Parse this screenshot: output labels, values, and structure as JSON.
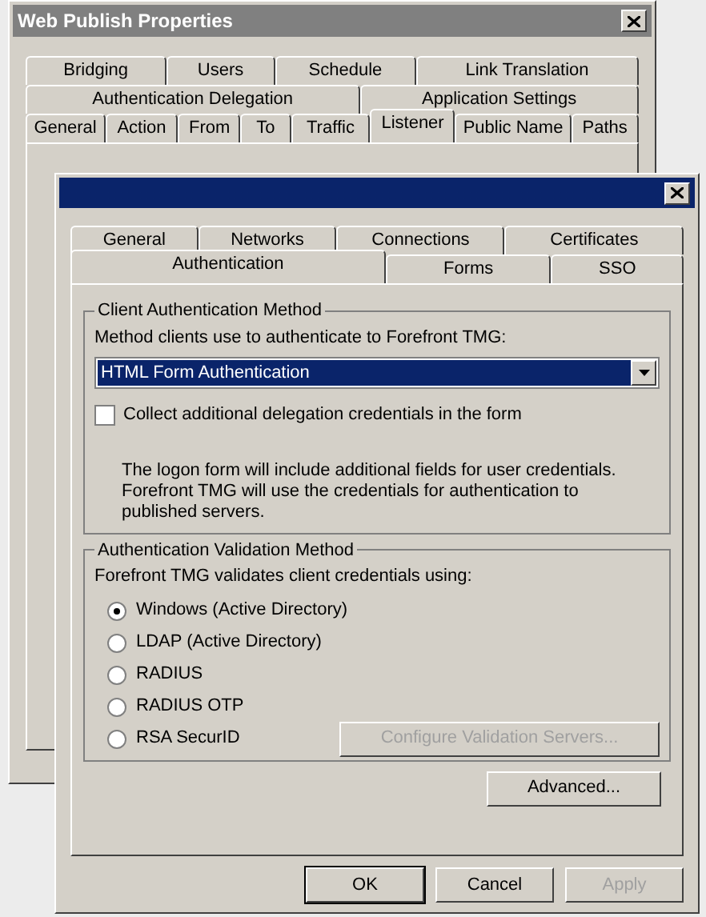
{
  "background_window": {
    "title": "Web Publish Properties",
    "tab_rows": [
      [
        {
          "label": "Bridging",
          "selected": false
        },
        {
          "label": "Users",
          "selected": false
        },
        {
          "label": "Schedule",
          "selected": false
        },
        {
          "label": "Link Translation",
          "selected": false
        }
      ],
      [
        {
          "label": "Authentication Delegation",
          "selected": false
        },
        {
          "label": "Application Settings",
          "selected": false
        }
      ],
      [
        {
          "label": "General",
          "selected": false
        },
        {
          "label": "Action",
          "selected": false
        },
        {
          "label": "From",
          "selected": false
        },
        {
          "label": "To",
          "selected": false
        },
        {
          "label": "Traffic",
          "selected": false
        },
        {
          "label": "Listener",
          "selected": true
        },
        {
          "label": "Public Name",
          "selected": false
        },
        {
          "label": "Paths",
          "selected": false
        }
      ]
    ]
  },
  "dialog": {
    "tab_rows": [
      [
        {
          "label": "General",
          "selected": false
        },
        {
          "label": "Networks",
          "selected": false
        },
        {
          "label": "Connections",
          "selected": false
        },
        {
          "label": "Certificates",
          "selected": false
        }
      ],
      [
        {
          "label": "Authentication",
          "selected": true
        },
        {
          "label": "Forms",
          "selected": false
        },
        {
          "label": "SSO",
          "selected": false
        }
      ]
    ],
    "client_auth": {
      "title": "Client Authentication Method",
      "prompt": "Method clients use to authenticate to Forefront TMG:",
      "method": "HTML Form Authentication",
      "delegation": {
        "label": "Collect additional delegation credentials in the form",
        "checked": false
      },
      "note": "The logon form will include additional fields for user credentials. Forefront TMG will use the credentials for authentication to published servers."
    },
    "validation": {
      "title": "Authentication Validation Method",
      "prompt": "Forefront TMG validates client credentials using:",
      "options": [
        {
          "label": "Windows (Active Directory)",
          "selected": true
        },
        {
          "label": "LDAP (Active Directory)",
          "selected": false
        },
        {
          "label": "RADIUS",
          "selected": false
        },
        {
          "label": "RADIUS OTP",
          "selected": false
        },
        {
          "label": "RSA SecurID",
          "selected": false
        }
      ],
      "configure_button": {
        "label": "Configure Validation Servers...",
        "disabled": true
      }
    },
    "advanced_button": "Advanced...",
    "buttons": [
      {
        "label": "OK",
        "default": true,
        "disabled": false
      },
      {
        "label": "Cancel",
        "default": false,
        "disabled": false
      },
      {
        "label": "Apply",
        "default": false,
        "disabled": true
      }
    ]
  }
}
